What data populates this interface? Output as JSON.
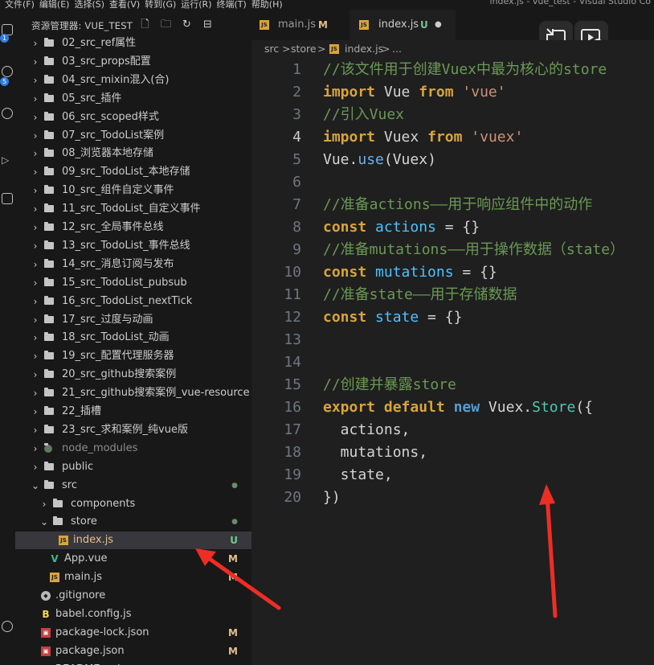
{
  "menu": {
    "items": [
      "文件(F)",
      "编辑(E)",
      "选择(S)",
      "查看(V)",
      "转到(G)",
      "运行(R)",
      "终端(T)",
      "帮助(H)"
    ],
    "title": "index.js - vue_test - Visual Studio Co"
  },
  "activity": {
    "badges": [
      "1",
      "5"
    ]
  },
  "explorer": {
    "title": "资源管理器: VUE_TEST",
    "actions": [
      "new-file-icon",
      "new-folder-icon",
      "refresh-icon",
      "collapse-icon"
    ],
    "rows": [
      {
        "label": "02_src_ref属性",
        "type": "folder",
        "depth": 0
      },
      {
        "label": "03_src_props配置",
        "type": "folder",
        "depth": 0
      },
      {
        "label": "04_src_mixin混入(合)",
        "type": "folder",
        "depth": 0
      },
      {
        "label": "05_src_插件",
        "type": "folder",
        "depth": 0
      },
      {
        "label": "06_src_scoped样式",
        "type": "folder",
        "depth": 0
      },
      {
        "label": "07_src_TodoList案例",
        "type": "folder",
        "depth": 0
      },
      {
        "label": "08_浏览器本地存储",
        "type": "folder",
        "depth": 0
      },
      {
        "label": "09_src_TodoList_本地存储",
        "type": "folder",
        "depth": 0
      },
      {
        "label": "10_src_组件自定义事件",
        "type": "folder",
        "depth": 0
      },
      {
        "label": "11_src_TodoList_自定义事件",
        "type": "folder",
        "depth": 0
      },
      {
        "label": "12_src_全局事件总线",
        "type": "folder",
        "depth": 0
      },
      {
        "label": "13_src_TodoList_事件总线",
        "type": "folder",
        "depth": 0
      },
      {
        "label": "14_src_消息订阅与发布",
        "type": "folder",
        "depth": 0
      },
      {
        "label": "15_src_TodoList_pubsub",
        "type": "folder",
        "depth": 0
      },
      {
        "label": "16_src_TodoList_nextTick",
        "type": "folder",
        "depth": 0
      },
      {
        "label": "17_src_过度与动画",
        "type": "folder",
        "depth": 0
      },
      {
        "label": "18_src_TodoList_动画",
        "type": "folder",
        "depth": 0
      },
      {
        "label": "19_src_配置代理服务器",
        "type": "folder",
        "depth": 0
      },
      {
        "label": "20_src_github搜索案例",
        "type": "folder",
        "depth": 0
      },
      {
        "label": "21_src_github搜索案例_vue-resource",
        "type": "folder",
        "depth": 0
      },
      {
        "label": "22_插槽",
        "type": "folder",
        "depth": 0
      },
      {
        "label": "23_src_求和案例_纯vue版",
        "type": "folder",
        "depth": 0
      },
      {
        "label": "node_modules",
        "type": "node",
        "depth": 0
      },
      {
        "label": "public",
        "type": "folder",
        "depth": 0
      },
      {
        "label": "src",
        "type": "folder-open",
        "depth": 0,
        "status": "●"
      },
      {
        "label": "components",
        "type": "folder",
        "depth": 1
      },
      {
        "label": "store",
        "type": "folder-open",
        "depth": 1,
        "status": "●"
      },
      {
        "label": "index.js",
        "type": "js",
        "depth": 2,
        "status": "U",
        "selected": true
      },
      {
        "label": "App.vue",
        "type": "vue",
        "depth": 1,
        "status": "M"
      },
      {
        "label": "main.js",
        "type": "js",
        "depth": 1,
        "status": "M"
      },
      {
        "label": ".gitignore",
        "type": "git",
        "depth": 0
      },
      {
        "label": "babel.config.js",
        "type": "babel",
        "depth": 0
      },
      {
        "label": "package-lock.json",
        "type": "npm",
        "depth": 0,
        "status": "M"
      },
      {
        "label": "package.json",
        "type": "npm",
        "depth": 0,
        "status": "M"
      },
      {
        "label": "README.md",
        "type": "md",
        "depth": 0
      }
    ]
  },
  "tabs": [
    {
      "label": "main.js",
      "status": "M",
      "active": false
    },
    {
      "label": "index.js",
      "status": "U",
      "active": true
    }
  ],
  "breadcrumb": {
    "parts": [
      "src",
      ">",
      "store",
      ">",
      "index.js",
      ">",
      "..."
    ]
  },
  "editor": {
    "current_line": 4,
    "lines": [
      [
        [
          "//该文件用于创建Vuex中最为核心的store",
          "c"
        ]
      ],
      [
        [
          "import",
          "k"
        ],
        [
          " Vue ",
          "i"
        ],
        [
          "from",
          "k"
        ],
        [
          " ",
          "p"
        ],
        [
          "'vue'",
          "s"
        ]
      ],
      [
        [
          "//引入Vuex",
          "c"
        ]
      ],
      [
        [
          "import",
          "k"
        ],
        [
          " Vuex ",
          "i"
        ],
        [
          "from",
          "k"
        ],
        [
          " ",
          "p"
        ],
        [
          "'vuex'",
          "s"
        ]
      ],
      [
        [
          "Vue",
          "i"
        ],
        [
          ".",
          "p"
        ],
        [
          "use",
          "f"
        ],
        [
          "(",
          "p"
        ],
        [
          "Vuex",
          "i"
        ],
        [
          ")",
          "p"
        ]
      ],
      [],
      [
        [
          "//准备actions——用于响应组件中的动作",
          "c"
        ]
      ],
      [
        [
          "const",
          "k"
        ],
        [
          " ",
          "p"
        ],
        [
          "actions",
          "v"
        ],
        [
          " = {}",
          "p"
        ]
      ],
      [
        [
          "//准备mutations——用于操作数据（state）",
          "c"
        ]
      ],
      [
        [
          "const",
          "k"
        ],
        [
          " ",
          "p"
        ],
        [
          "mutations",
          "v"
        ],
        [
          " = {}",
          "p"
        ]
      ],
      [
        [
          "//准备state——用于存储数据",
          "c"
        ]
      ],
      [
        [
          "const",
          "k"
        ],
        [
          " ",
          "p"
        ],
        [
          "state",
          "v"
        ],
        [
          " = {}",
          "p"
        ]
      ],
      [],
      [],
      [
        [
          "//创建并暴露store",
          "c"
        ]
      ],
      [
        [
          "export",
          "k"
        ],
        [
          " ",
          "p"
        ],
        [
          "default",
          "k"
        ],
        [
          " ",
          "p"
        ],
        [
          "new",
          "b"
        ],
        [
          " Vuex.",
          "i"
        ],
        [
          "Store",
          "t"
        ],
        [
          "({",
          "p"
        ]
      ],
      [
        [
          "  actions,",
          "i"
        ]
      ],
      [
        [
          "  mutations,",
          "i"
        ]
      ],
      [
        [
          "  state,",
          "i"
        ]
      ],
      [
        [
          "})",
          "p"
        ]
      ]
    ]
  },
  "colors": {
    "c": "#6a9955",
    "k": "#d8a53a",
    "i": "#d4d4d4",
    "s": "#ce9178",
    "f": "#6fb3e8",
    "v": "#4fc1ff",
    "b": "#569cd6",
    "t": "#4ec9b0",
    "p": "#d4d4d4",
    "status_U": "#73c991",
    "status_M": "#e2c08d",
    "arrow": "#ee2d24"
  },
  "overlay": {
    "icons": [
      "picture-in-picture-icon",
      "video-search-icon"
    ]
  }
}
